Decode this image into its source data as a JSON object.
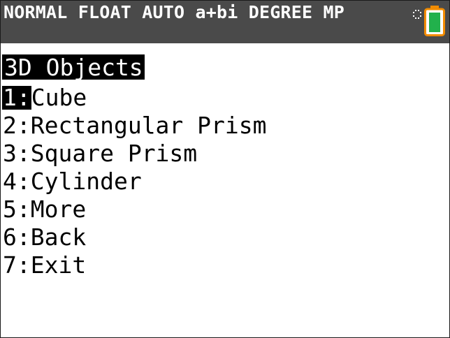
{
  "status_bar": {
    "text": "NORMAL FLOAT AUTO a+bi DEGREE MP",
    "icons": [
      "busy-indicator-icon",
      "battery-icon"
    ],
    "colors": {
      "background": "#4a4a4a",
      "text": "#ffffff",
      "battery_outline": "#f28c00",
      "battery_fill": "#22b14c"
    }
  },
  "menu": {
    "title": "3D Objects",
    "selected_index": 0,
    "items": [
      {
        "number": "1:",
        "label": "Cube"
      },
      {
        "number": "2:",
        "label": "Rectangular Prism"
      },
      {
        "number": "3:",
        "label": "Square Prism"
      },
      {
        "number": "4:",
        "label": "Cylinder"
      },
      {
        "number": "5:",
        "label": "More"
      },
      {
        "number": "6:",
        "label": "Back"
      },
      {
        "number": "7:",
        "label": "Exit"
      }
    ]
  }
}
